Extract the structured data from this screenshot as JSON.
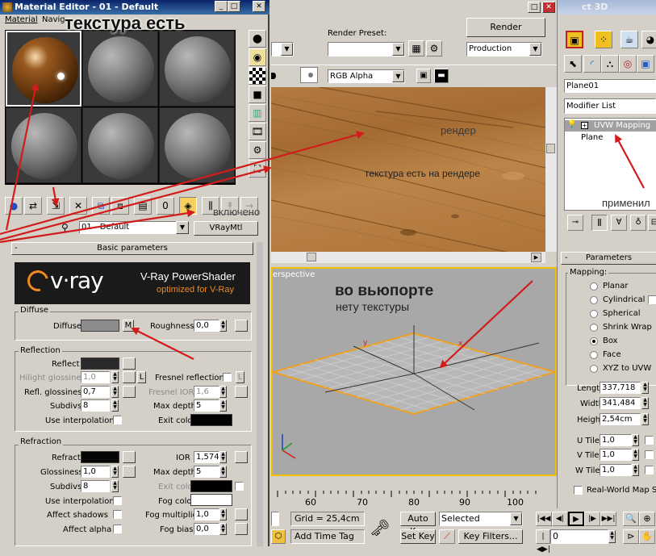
{
  "material_editor": {
    "title": "Material Editor - 01 - Default",
    "menu": [
      "Material",
      "Navig"
    ],
    "material_name": "01 - Default",
    "material_type": "VRayMtl",
    "rollout_title": "Basic parameters",
    "vray_banner": {
      "logo": "v·ray",
      "title": "V-Ray PowerShader",
      "subtitle": "optimized for V-Ray"
    },
    "diffuse": {
      "group": "Diffuse",
      "diffuse_label": "Diffuse",
      "map_button": "M",
      "roughness_label": "Roughness",
      "roughness": "0,0"
    },
    "reflection": {
      "group": "Reflection",
      "reflect_label": "Reflect",
      "hilight_label": "Hilight glossiness",
      "hilight": "1,0",
      "hilight_lock": "L",
      "fresnel_label": "Fresnel reflections",
      "fresnel_lock": "L",
      "refl_gloss_label": "Refl. glossiness",
      "refl_gloss": "0,7",
      "fresnel_ior_label": "Fresnel IOR",
      "fresnel_ior": "1,6",
      "subdivs_label": "Subdivs",
      "subdivs": "8",
      "max_depth_label": "Max depth",
      "max_depth": "5",
      "use_interp_label": "Use interpolation",
      "exit_color_label": "Exit color"
    },
    "refraction": {
      "group": "Refraction",
      "refract_label": "Refract",
      "ior_label": "IOR",
      "ior": "1,574",
      "gloss_label": "Glossiness",
      "gloss": "1,0",
      "max_depth_label": "Max depth",
      "max_depth": "5",
      "subdivs_label": "Subdivs",
      "subdivs": "8",
      "exit_color_label": "Exit color",
      "use_interp_label": "Use interpolation",
      "fog_color_label": "Fog color",
      "affect_shadows_label": "Affect shadows",
      "fog_mult_label": "Fog multiplier",
      "fog_mult": "1,0",
      "affect_alpha_label": "Affect alpha",
      "fog_bias_label": "Fog bias",
      "fog_bias": "0,0"
    }
  },
  "render_window": {
    "preset_label": "Render Preset:",
    "render_button": "Render",
    "production": "Production",
    "channel": "RGB Alpha"
  },
  "viewport": {
    "label": "erspective",
    "ruler": [
      "60",
      "70",
      "80",
      "90",
      "100"
    ]
  },
  "statusbar": {
    "grid": "Grid = 25,4cm",
    "add_time_tag": "Add Time Tag",
    "auto_key": "Auto Key",
    "set_key": "Set Key",
    "selected": "Selected",
    "key_filters": "Key Filters...",
    "frame": "0"
  },
  "command_panel": {
    "title_fragment": "ct 3D",
    "object_name": "Plane01",
    "modifier_list": "Modifier List",
    "stack": [
      "UVW Mapping",
      "Plane"
    ],
    "rollout_title": "Parameters",
    "mapping_label": "Mapping:",
    "mapping_options": [
      "Planar",
      "Cylindrical",
      "Spherical",
      "Shrink Wrap",
      "Box",
      "Face",
      "XYZ to UVW"
    ],
    "mapping_selected": "Box",
    "length_label": "Length:",
    "length": "337,718",
    "width_label": "Width:",
    "width": "341,484",
    "height_label": "Height:",
    "height": "2,54cm",
    "utile_label": "U Tile:",
    "utile": "1,0",
    "vtile_label": "V Tile:",
    "vtile": "1,0",
    "wtile_label": "W Tile:",
    "wtile": "1,0",
    "real_world_label": "Real-World Map Siz"
  },
  "annotations": {
    "texture_exists": "текстура есть",
    "render": "рендер",
    "texture_on_render": "текстура есть на рендере",
    "enabled": "включено",
    "applied": "применил",
    "in_viewport": "во вьюпорте",
    "no_texture": "нету текстуры"
  },
  "colors": {
    "annotation_red": "#d21c1c",
    "selection_orange": "#f0a020",
    "vray_orange": "#f08a1e"
  }
}
